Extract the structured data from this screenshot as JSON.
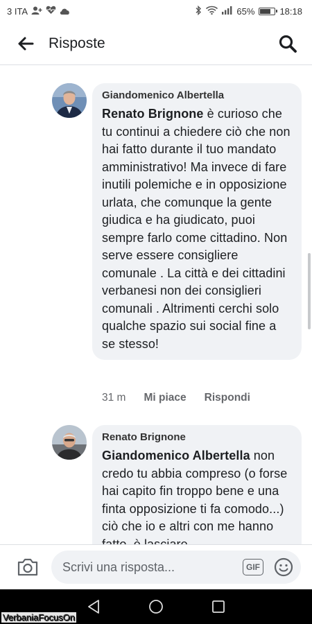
{
  "status_bar": {
    "carrier": "3 ITA",
    "battery": "65%",
    "battery_level": 0.65,
    "time": "18:18",
    "icons": [
      "person-add-icon",
      "heart-monitor-icon",
      "cloud-icon",
      "bluetooth-icon",
      "wifi-icon",
      "signal-icon",
      "battery-icon"
    ]
  },
  "header": {
    "title": "Risposte",
    "back_icon": "arrow-left-icon",
    "search_icon": "search-icon"
  },
  "comments": [
    {
      "author": "Giandomenico Albertella",
      "mention": "Renato Brignone",
      "text": " è curioso che tu continui a chiedere ciò che non hai fatto durante il tuo mandato amministrativo! Ma invece di fare inutili polemiche e in opposizione urlata, che comunque la gente giudica e ha giudicato, puoi sempre farlo come cittadino. Non serve essere consigliere comunale . La città e dei cittadini verbanesi non dei consiglieri comunali . Altrimenti cerchi solo qualche spazio sui social fine a se stesso!",
      "time": "31 m",
      "like_label": "Mi piace",
      "reply_label": "Rispondi"
    },
    {
      "author": "Renato Brignone",
      "mention": "Giandomenico Albertella",
      "text": " non credo tu abbia compreso (o forse hai capito fin troppo bene e una finta opposizione ti fa comodo...) ciò che io e altri con me hanno fatto, è lasciare"
    }
  ],
  "composer": {
    "placeholder": "Scrivi una risposta...",
    "gif_label": "GIF",
    "camera_icon": "camera-icon",
    "emoji_icon": "smiley-icon"
  },
  "nav": {
    "icons": [
      "back-triangle-icon",
      "home-circle-icon",
      "recents-square-icon"
    ]
  },
  "watermark": "VerbaniaFocusOn",
  "colors": {
    "bubble": "#f0f2f5",
    "text": "#1c1e21",
    "meta": "#65676b"
  }
}
